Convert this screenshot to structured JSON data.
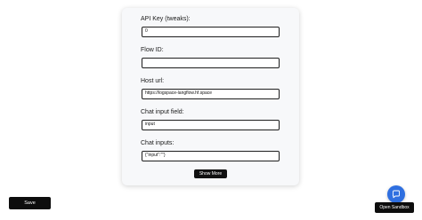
{
  "form": {
    "api_key": {
      "label": "API Key (tweaks):",
      "value": "0"
    },
    "flow_id": {
      "label": "Flow ID:",
      "value": ""
    },
    "host_url": {
      "label": "Host url:",
      "value": "https://logspace-langflow.hf.space"
    },
    "chat_input_field": {
      "label": "Chat input field:",
      "value": "input"
    },
    "chat_inputs": {
      "label": "Chat inputs:",
      "value": "{\"input\":\"\"}"
    },
    "show_more_label": "Show More"
  },
  "footer": {
    "save_label": "Save",
    "open_sandbox_label": "Open Sandbox",
    "chat_icon": "chat-bubble-icon"
  },
  "colors": {
    "card_background": "#f7f8fa",
    "button_background": "#0d0d0d",
    "chat_fab": "#2f6fe0"
  }
}
